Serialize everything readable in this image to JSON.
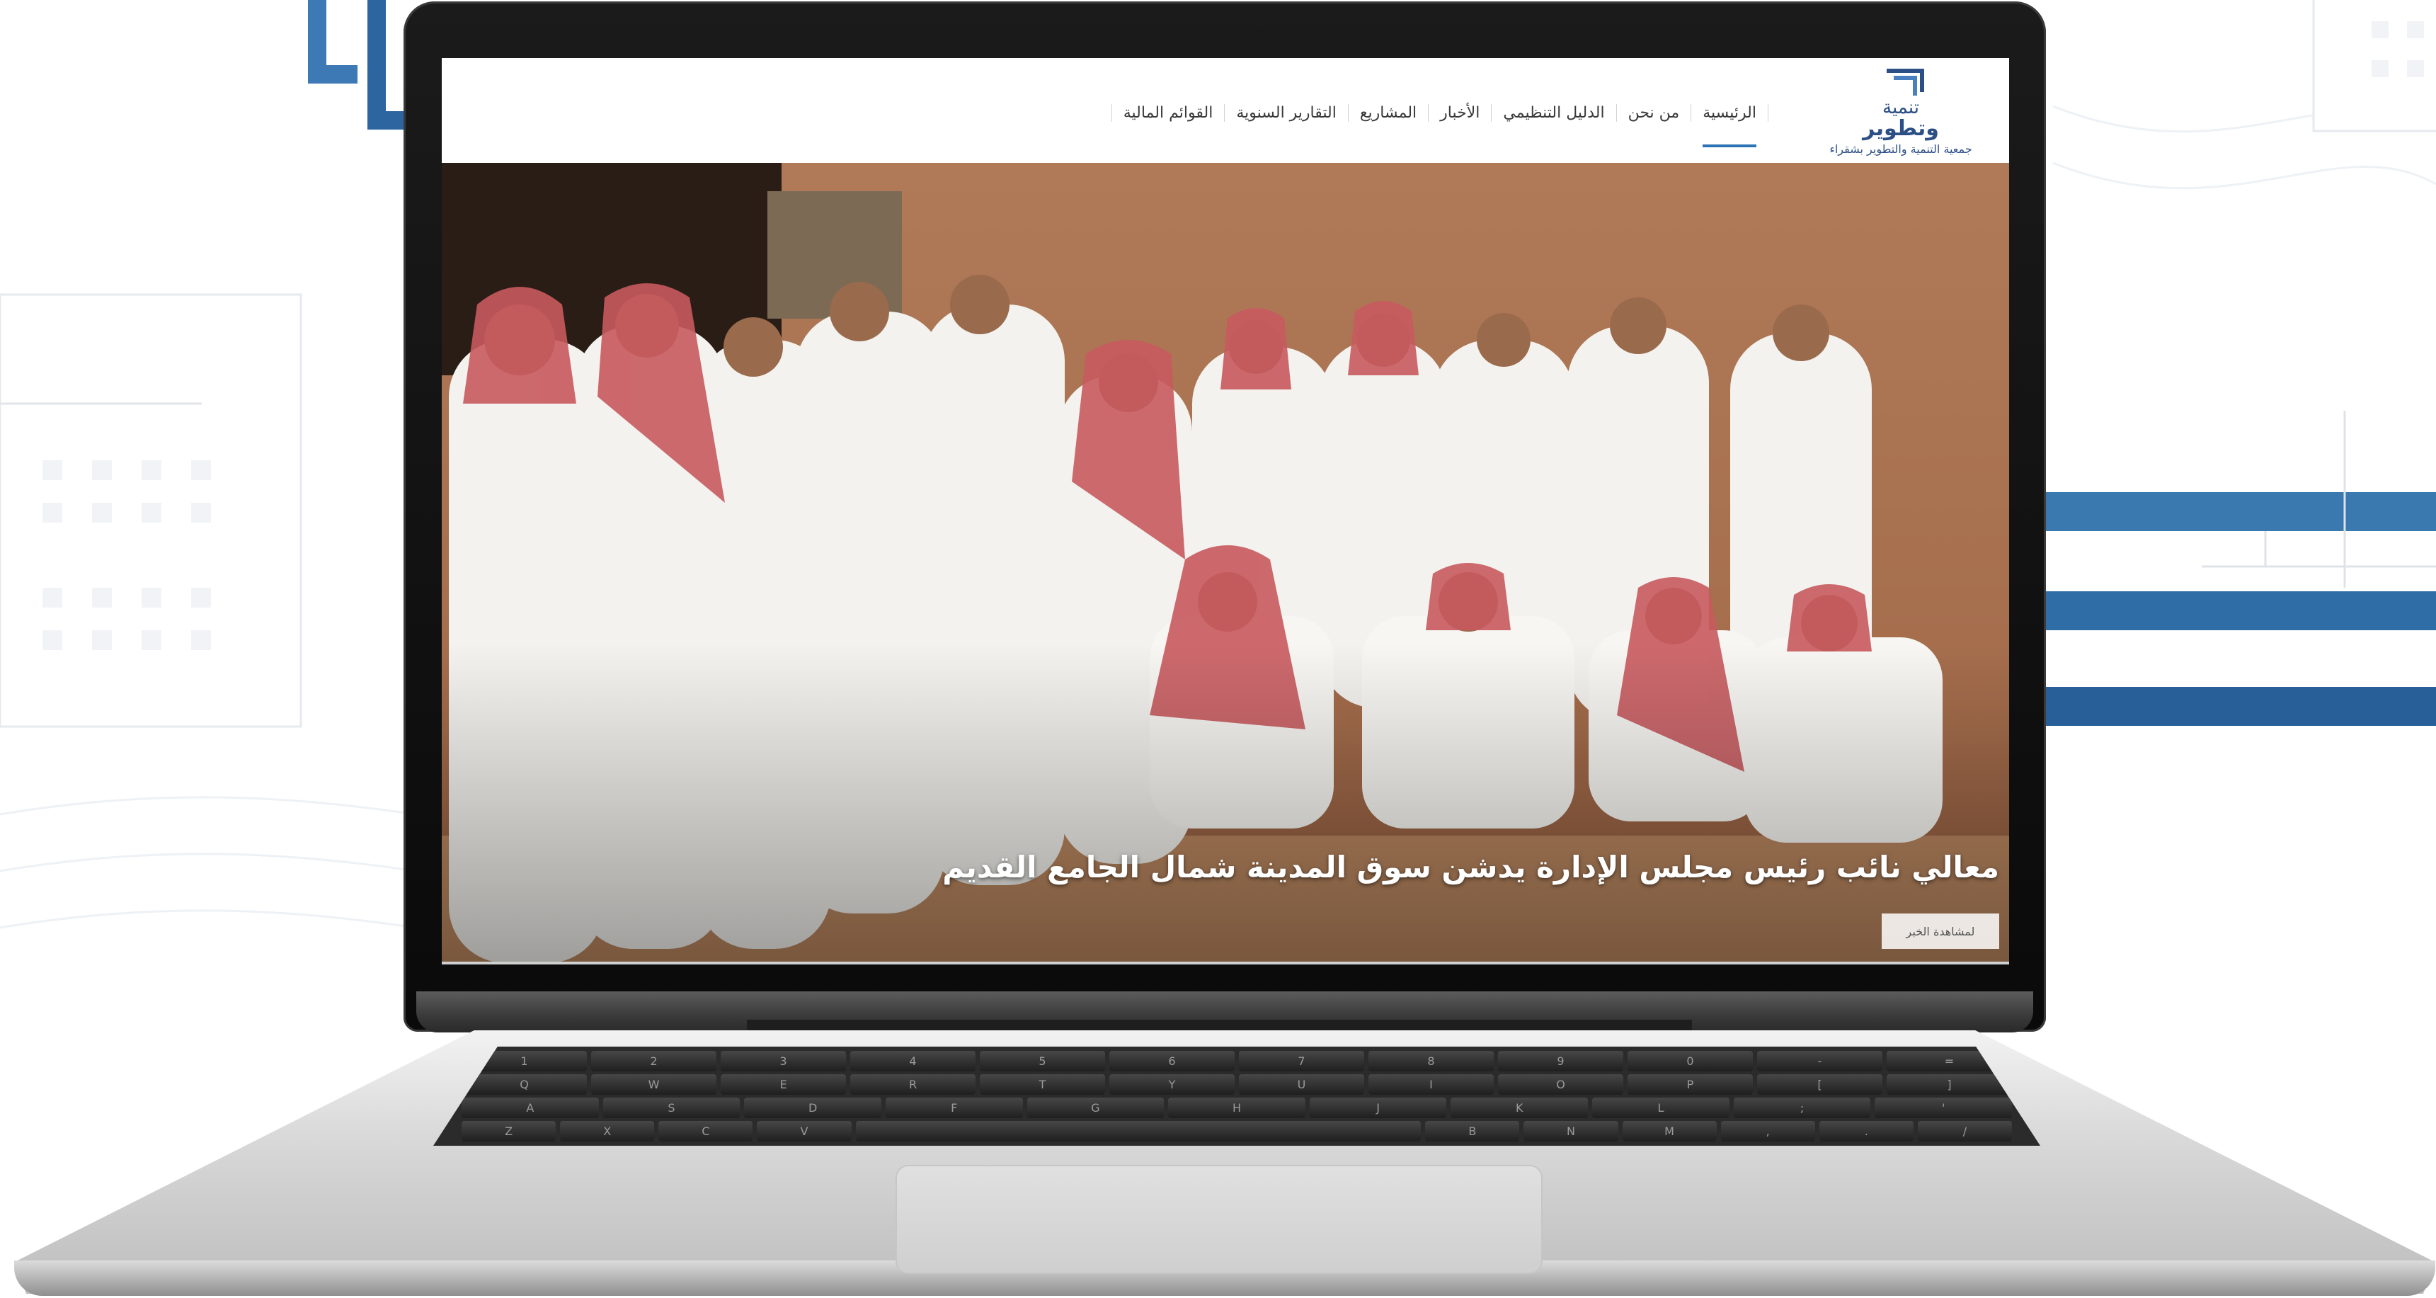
{
  "site": {
    "logo": {
      "name": "وتطوير",
      "name_top": "تنمية",
      "subtitle": "جمعية التنمية والتطوير بشقراء"
    },
    "nav": [
      {
        "label": "الرئيسية",
        "active": true
      },
      {
        "label": "من نحن",
        "active": false
      },
      {
        "label": "الدليل التنظيمي",
        "active": false
      },
      {
        "label": "الأخبار",
        "active": false
      },
      {
        "label": "المشاريع",
        "active": false
      },
      {
        "label": "التقارير السنوية",
        "active": false
      },
      {
        "label": "القوائم المالية",
        "active": false
      }
    ],
    "hero": {
      "title": "معالي نائب رئيس مجلس الإدارة يدشن سوق المدينة شمال الجامع القديم",
      "button_label": "لمشاهدة الخبر"
    }
  },
  "keyboard": {
    "row1": [
      "1",
      "2",
      "3",
      "4",
      "5",
      "6",
      "7",
      "8",
      "9",
      "0",
      "-",
      "="
    ],
    "row2": [
      "Q",
      "W",
      "E",
      "R",
      "T",
      "Y",
      "U",
      "I",
      "O",
      "P",
      "[",
      "]"
    ],
    "row3": [
      "A",
      "S",
      "D",
      "F",
      "G",
      "H",
      "J",
      "K",
      "L",
      ";",
      "'"
    ],
    "row4": [
      "Z",
      "X",
      "C",
      "V",
      "B",
      "N",
      "M",
      ",",
      ".",
      "/"
    ]
  },
  "colors": {
    "accent": "#2c74b3",
    "brand_dark": "#2c4f85",
    "stripe_blue": "#2f6da6"
  }
}
